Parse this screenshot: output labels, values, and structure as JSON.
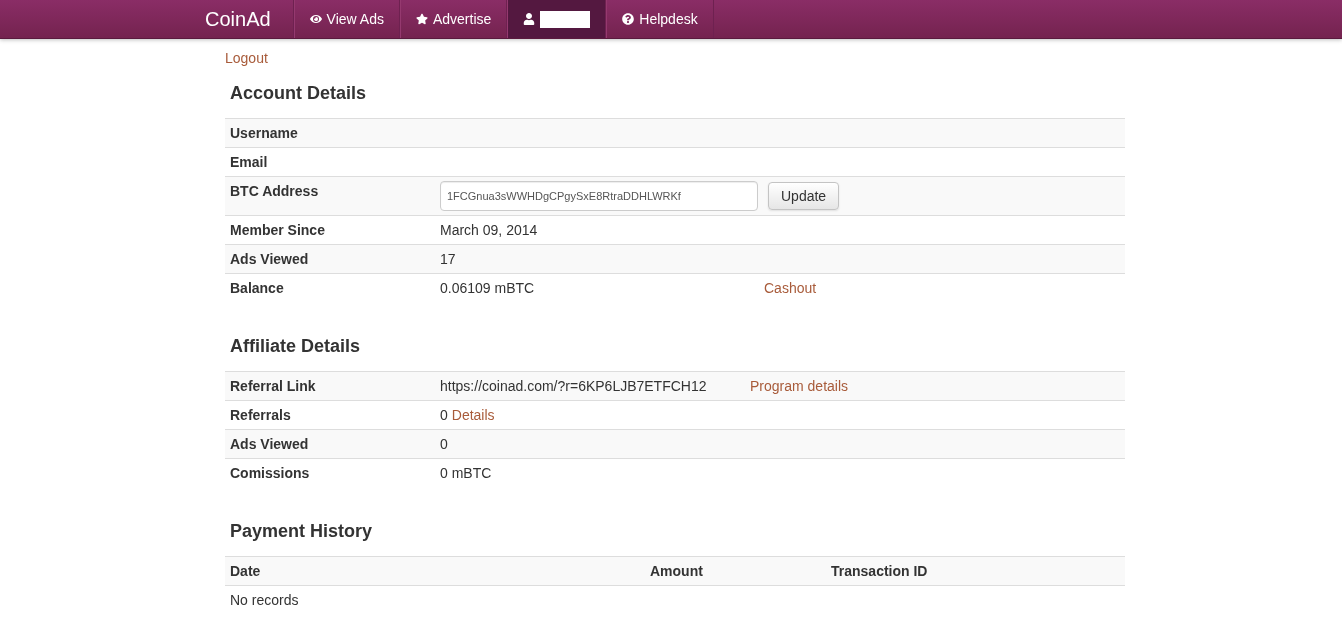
{
  "navbar": {
    "brand": "CoinAd",
    "items": [
      {
        "kind": "link",
        "label": "View Ads",
        "selected": false
      },
      {
        "kind": "link",
        "label": "Advertise",
        "selected": false
      },
      {
        "kind": "redacted",
        "selected": true
      },
      {
        "kind": "link",
        "label": "Helpdesk",
        "selected": false
      }
    ]
  },
  "logout": "Logout",
  "account": {
    "title": "Account Details",
    "rows": [
      {
        "kind": "text",
        "label": "Username"
      },
      {
        "kind": "text",
        "label": "Email"
      },
      {
        "kind": "address",
        "label": "BTC Address",
        "value": "1FCGnua3sWWHDgCPgySxE8RtraDDHLWRKf",
        "button": "Update"
      },
      {
        "kind": "text",
        "label": "Member Since",
        "value": "March 09, 2014"
      },
      {
        "kind": "text",
        "label": "Ads Viewed",
        "value": "17"
      },
      {
        "kind": "text",
        "label": "Balance",
        "value": "0.06109 mBTC",
        "action": "Cashout"
      }
    ]
  },
  "affiliate": {
    "title": "Affiliate Details",
    "rows": [
      {
        "kind": "text",
        "label": "Referral Link",
        "value": "https://coinad.com/?r=6KP6LJB7ETFCH12",
        "action": "Program details"
      },
      {
        "kind": "text",
        "label": "Referrals",
        "value": "0",
        "link": "Details"
      },
      {
        "kind": "text",
        "label": "Ads Viewed",
        "value": "0"
      },
      {
        "kind": "text",
        "label": "Comissions",
        "value": "0 mBTC"
      }
    ]
  },
  "payments": {
    "title": "Payment History",
    "columns": [
      "Date",
      "Amount",
      "Transaction ID"
    ],
    "empty": "No records"
  }
}
